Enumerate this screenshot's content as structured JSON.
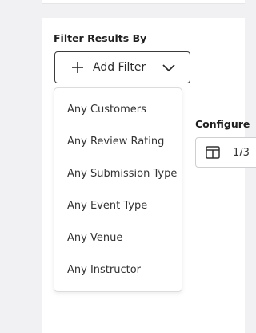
{
  "filter": {
    "heading": "Filter Results By",
    "add_filter_label": "Add Filter",
    "options": [
      "Any Customers",
      "Any Review Rating",
      "Any Submission Type",
      "Any Event Type",
      "Any Venue",
      "Any Instructor"
    ]
  },
  "configure": {
    "heading": "Configure",
    "date_value": "1/3"
  },
  "icons": {
    "add": "plus-icon",
    "dropdown": "chevron-down-icon",
    "date": "calendar-icon"
  }
}
